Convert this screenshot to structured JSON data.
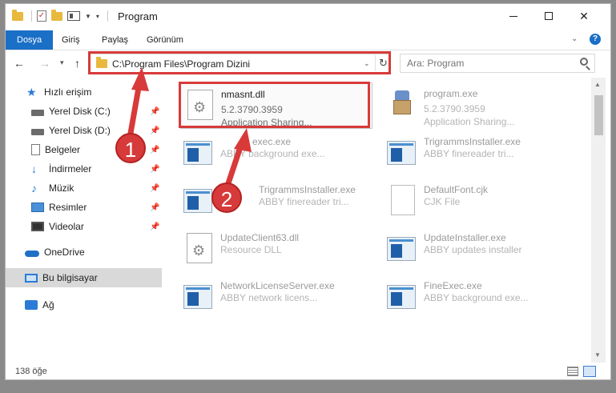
{
  "window": {
    "title": "Program"
  },
  "ribbon": {
    "tabs": [
      "Dosya",
      "Giriş",
      "Paylaş",
      "Görünüm"
    ]
  },
  "address": {
    "path": "C:\\Program Files\\Program Dizini"
  },
  "search": {
    "placeholder": "Ara: Program"
  },
  "sidebar": {
    "items": [
      {
        "label": "Hızlı erişim",
        "icon": "star-icon",
        "pinned": false
      },
      {
        "label": "Yerel Disk (C:)",
        "icon": "drive-icon",
        "pinned": true
      },
      {
        "label": "Yerel Disk (D:)",
        "icon": "drive-icon",
        "pinned": true
      },
      {
        "label": "Belgeler",
        "icon": "document-icon",
        "pinned": true
      },
      {
        "label": "İndirmeler",
        "icon": "download-icon",
        "pinned": true
      },
      {
        "label": "Müzik",
        "icon": "music-icon",
        "pinned": true
      },
      {
        "label": "Resimler",
        "icon": "picture-icon",
        "pinned": true
      },
      {
        "label": "Videolar",
        "icon": "video-icon",
        "pinned": true
      },
      {
        "label": "OneDrive",
        "icon": "cloud-icon",
        "pinned": false
      },
      {
        "label": "Bu bilgisayar",
        "icon": "computer-icon",
        "pinned": false,
        "selected": true
      },
      {
        "label": "Ağ",
        "icon": "network-icon",
        "pinned": false
      }
    ]
  },
  "files": [
    {
      "name": "nmasnt.dll",
      "line2": "5.2.3790.3959",
      "line3": "Application Sharing...",
      "icon": "dll-gear-icon",
      "selected": true
    },
    {
      "name": "program.exe",
      "line2": "5.2.3790.3959",
      "line3": "Application Sharing...",
      "icon": "setup-icon"
    },
    {
      "name": "exec.exe",
      "line2": "ABBY background exe...",
      "line3": "",
      "icon": "exe-window-icon"
    },
    {
      "name": "TrigrammsInstaller.exe",
      "line2": "ABBY finereader tri...",
      "line3": "",
      "icon": "exe-window-icon"
    },
    {
      "name": "TrigrammsInstaller.exe",
      "line2": "ABBY finereader tri...",
      "line3": "",
      "icon": "exe-window-icon"
    },
    {
      "name": "DefaultFont.cjk",
      "line2": "CJK File",
      "line3": "",
      "icon": "blank-file-icon"
    },
    {
      "name": "UpdateClient63.dll",
      "line2": "Resource DLL",
      "line3": "",
      "icon": "dll-gear-icon"
    },
    {
      "name": "UpdateInstaller.exe",
      "line2": "ABBY updates installer",
      "line3": "",
      "icon": "exe-window-icon"
    },
    {
      "name": "NetworkLicenseServer.exe",
      "line2": "ABBY network licens...",
      "line3": "",
      "icon": "exe-window-icon"
    },
    {
      "name": "FineExec.exe",
      "line2": "ABBY background exe...",
      "line3": "",
      "icon": "exe-window-icon"
    }
  ],
  "status": {
    "count": "138 öğe"
  },
  "annotations": {
    "step1": "1",
    "step2": "2",
    "color": "#d83a3a"
  }
}
